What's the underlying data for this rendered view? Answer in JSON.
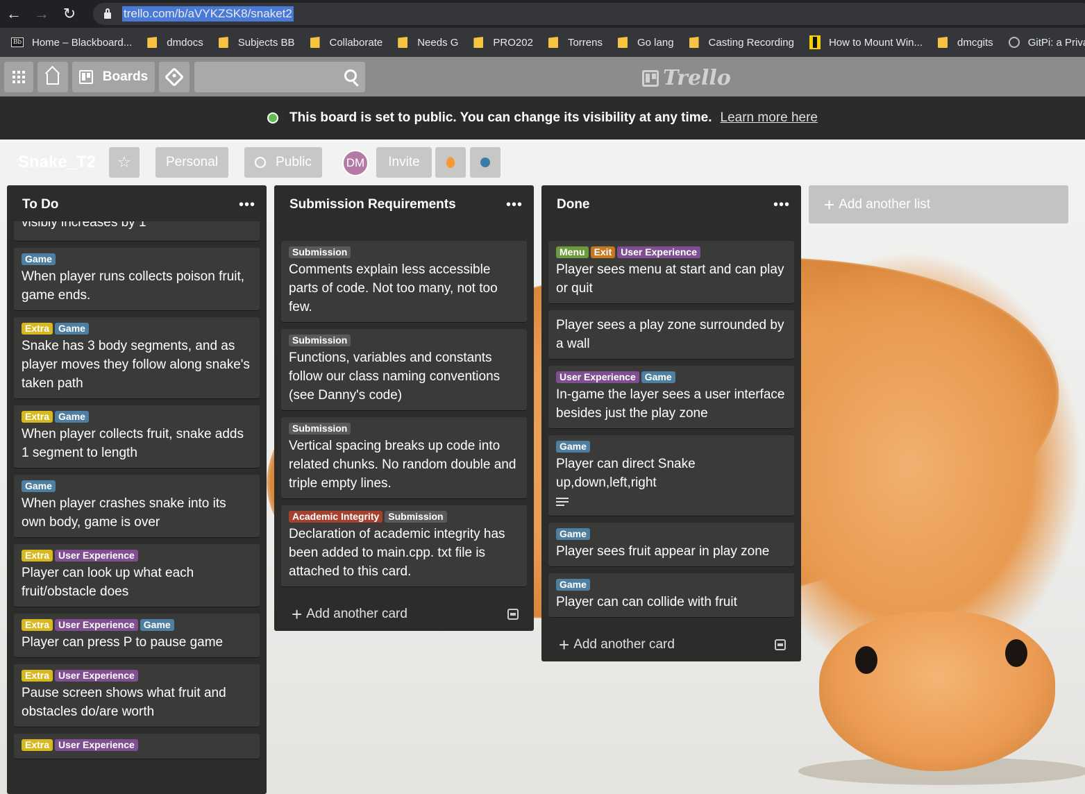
{
  "browser": {
    "url": "trello.com/b/aVYKZSK8/snaket2",
    "bookmarks": [
      {
        "label": "Home – Blackboard...",
        "icon": "blackboard-icon"
      },
      {
        "label": "dmdocs",
        "icon": "folder-icon"
      },
      {
        "label": "Subjects BB",
        "icon": "folder-icon"
      },
      {
        "label": "Collaborate",
        "icon": "folder-icon"
      },
      {
        "label": "Needs G",
        "icon": "folder-icon"
      },
      {
        "label": "PRO202",
        "icon": "folder-icon"
      },
      {
        "label": "Torrens",
        "icon": "folder-icon"
      },
      {
        "label": "Go lang",
        "icon": "folder-icon"
      },
      {
        "label": "Casting Recording",
        "icon": "folder-icon"
      },
      {
        "label": "How to Mount Win...",
        "icon": "mount-icon"
      },
      {
        "label": "dmcgits",
        "icon": "folder-icon"
      },
      {
        "label": "GitPi: a Privat",
        "icon": "globe-icon"
      }
    ]
  },
  "header": {
    "boards_label": "Boards",
    "logo_text": "Trello"
  },
  "banner": {
    "text": "This board is set to public. You can change its visibility at any time.",
    "link": "Learn more here"
  },
  "board": {
    "title": "Snake_T2",
    "team": "Personal",
    "visibility": "Public",
    "member_initials": "DM",
    "invite_label": "Invite"
  },
  "label_colors": {
    "Game": "#4f7fa0",
    "Extra": "#d7b81e",
    "User Experience": "#7f4f91",
    "Submission": "#5a5a5a",
    "Academic Integrity": "#a4422f",
    "Menu": "#6c9a3c",
    "Exit": "#c6781f"
  },
  "lists": [
    {
      "title": "To Do",
      "cards": [
        {
          "labels": [],
          "text": "visibly increases by 1",
          "clipped": true
        },
        {
          "labels": [
            "Game"
          ],
          "text": "When player runs collects poison fruit, game ends."
        },
        {
          "labels": [
            "Extra",
            "Game"
          ],
          "text": "Snake has 3 body segments, and as player moves they follow along snake's taken path"
        },
        {
          "labels": [
            "Extra",
            "Game"
          ],
          "text": "When player collects fruit, snake adds 1 segment to length"
        },
        {
          "labels": [
            "Game"
          ],
          "text": "When player crashes snake into its own body, game is over"
        },
        {
          "labels": [
            "Extra",
            "User Experience"
          ],
          "text": "Player can look up what each fruit/obstacle does"
        },
        {
          "labels": [
            "Extra",
            "User Experience",
            "Game"
          ],
          "text": "Player can press P to pause game"
        },
        {
          "labels": [
            "Extra",
            "User Experience"
          ],
          "text": "Pause screen shows what fruit and obstacles do/are worth"
        },
        {
          "labels": [
            "Extra",
            "User Experience"
          ],
          "text": ""
        }
      ]
    },
    {
      "title": "Submission Requirements",
      "cards": [
        {
          "labels": [
            "Submission"
          ],
          "text": "Comments explain less accessible parts of code. Not too many, not too few."
        },
        {
          "labels": [
            "Submission"
          ],
          "text": "Functions, variables and constants follow our class naming conventions (see Danny's code)"
        },
        {
          "labels": [
            "Submission"
          ],
          "text": "Vertical spacing breaks up code into related chunks. No random double and triple empty lines."
        },
        {
          "labels": [
            "Academic Integrity",
            "Submission"
          ],
          "text": "Declaration of academic integrity has been added to main.cpp. txt file is attached to this card."
        }
      ],
      "add_card": "Add another card"
    },
    {
      "title": "Done",
      "cards": [
        {
          "labels": [
            "Menu",
            "Exit",
            "User Experience"
          ],
          "text": "Player sees menu at start and can play or quit"
        },
        {
          "labels": [],
          "text": "Player sees a play zone surrounded by a wall"
        },
        {
          "labels": [
            "User Experience",
            "Game"
          ],
          "text": "In-game the layer sees a user interface besides just the play zone"
        },
        {
          "labels": [
            "Game"
          ],
          "text": "Player can direct Snake up,down,left,right",
          "has_description": true
        },
        {
          "labels": [
            "Game"
          ],
          "text": "Player sees fruit appear in play zone"
        },
        {
          "labels": [
            "Game"
          ],
          "text": "Player can can collide with fruit"
        }
      ],
      "add_card": "Add another card"
    }
  ],
  "add_list": "Add another list"
}
